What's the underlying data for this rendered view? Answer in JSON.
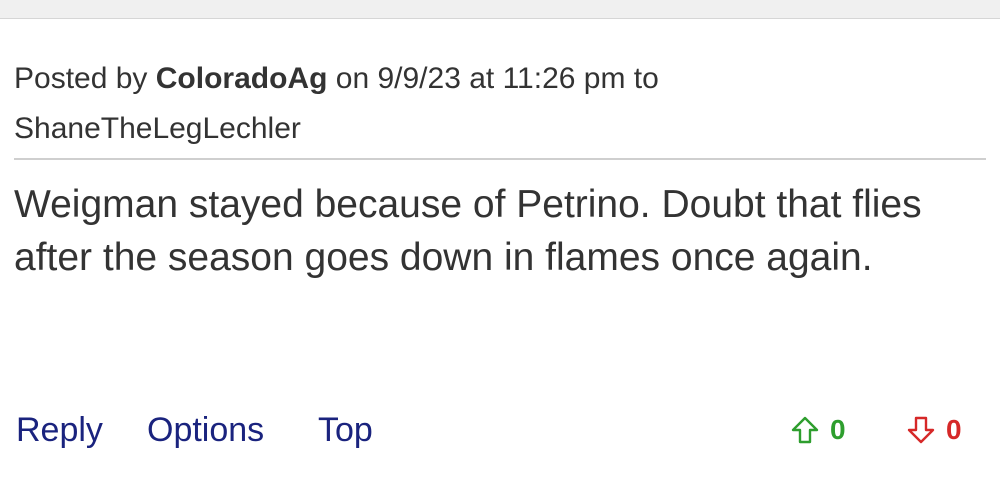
{
  "post": {
    "posted_by_prefix": "Posted by ",
    "author": "ColoradoAg",
    "on_prefix": " on ",
    "date": "9/9/23",
    "at_prefix": " at ",
    "time": "11:26 pm",
    "to_prefix": " to",
    "recipient": "ShaneTheLegLechler",
    "body": "Weigman stayed because of Petrino. Doubt that flies after the season goes down in flames once again."
  },
  "actions": {
    "reply": "Reply",
    "options": "Options",
    "top": "Top"
  },
  "votes": {
    "up_icon": "arrow-up-outline-icon",
    "up_count": "0",
    "up_color": "#2e9e2e",
    "down_icon": "arrow-down-outline-icon",
    "down_count": "0",
    "down_color": "#d62828"
  },
  "colors": {
    "link": "#1a237e",
    "text": "#333333"
  }
}
